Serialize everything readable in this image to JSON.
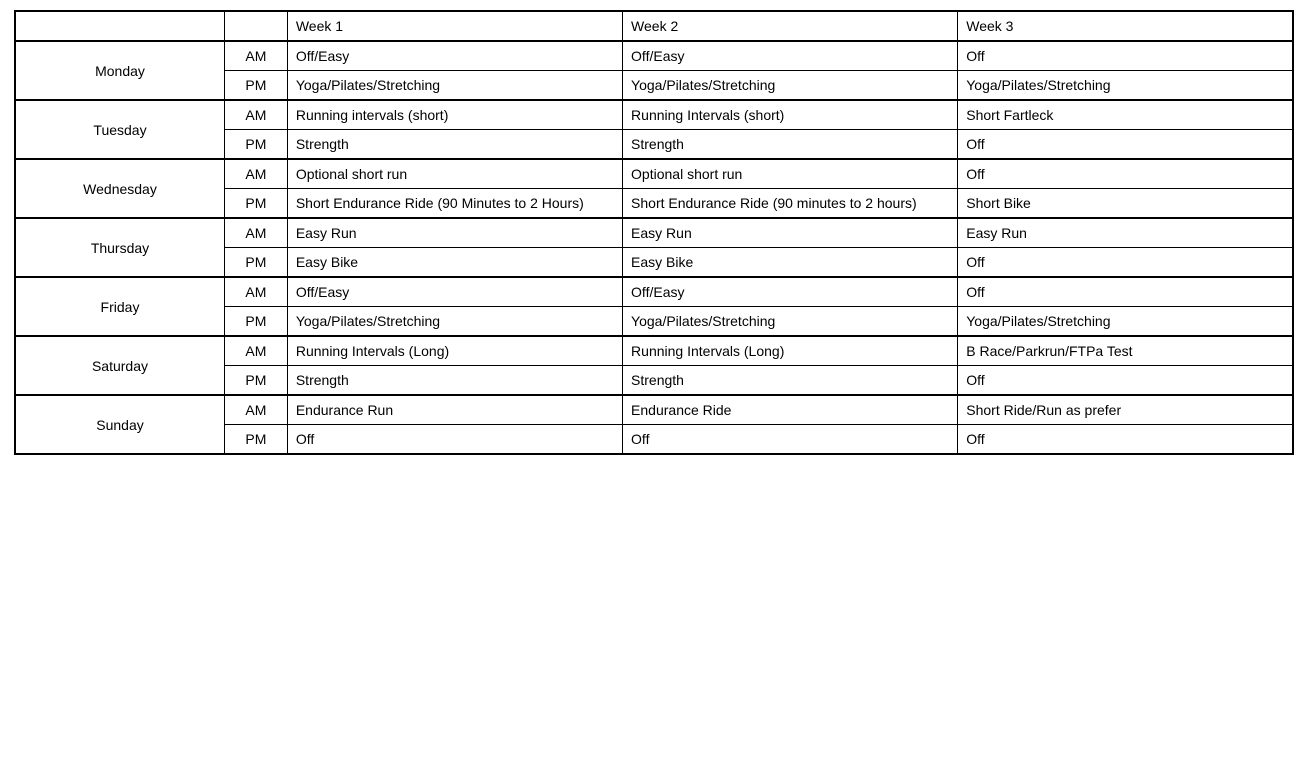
{
  "headers": {
    "col1": "",
    "col2": "",
    "week1": "Week 1",
    "week2": "Week 2",
    "week3": "Week 3"
  },
  "days": [
    {
      "name": "Monday",
      "rows": [
        {
          "period": "AM",
          "w1": "Off/Easy",
          "w2": "Off/Easy",
          "w3": "Off"
        },
        {
          "period": "PM",
          "w1": "Yoga/Pilates/Stretching",
          "w2": "Yoga/Pilates/Stretching",
          "w3": "Yoga/Pilates/Stretching"
        }
      ]
    },
    {
      "name": "Tuesday",
      "rows": [
        {
          "period": "AM",
          "w1": "Running intervals (short)",
          "w2": "Running Intervals (short)",
          "w3": "Short Fartleck"
        },
        {
          "period": "PM",
          "w1": "Strength",
          "w2": "Strength",
          "w3": "Off"
        }
      ]
    },
    {
      "name": "Wednesday",
      "rows": [
        {
          "period": "AM",
          "w1": "Optional short run",
          "w2": "Optional short run",
          "w3": "Off"
        },
        {
          "period": "PM",
          "w1": "Short Endurance Ride (90 Minutes to 2 Hours)",
          "w2": "Short Endurance Ride (90 minutes to 2 hours)",
          "w3": "Short Bike"
        }
      ]
    },
    {
      "name": "Thursday",
      "rows": [
        {
          "period": "AM",
          "w1": "Easy Run",
          "w2": "Easy Run",
          "w3": "Easy Run"
        },
        {
          "period": "PM",
          "w1": "Easy Bike",
          "w2": "Easy Bike",
          "w3": "Off"
        }
      ]
    },
    {
      "name": "Friday",
      "rows": [
        {
          "period": "AM",
          "w1": "Off/Easy",
          "w2": "Off/Easy",
          "w3": "Off"
        },
        {
          "period": "PM",
          "w1": "Yoga/Pilates/Stretching",
          "w2": "Yoga/Pilates/Stretching",
          "w3": "Yoga/Pilates/Stretching"
        }
      ]
    },
    {
      "name": "Saturday",
      "rows": [
        {
          "period": "AM",
          "w1": "Running Intervals (Long)",
          "w2": "Running Intervals (Long)",
          "w3": "B Race/Parkrun/FTPa Test"
        },
        {
          "period": "PM",
          "w1": "Strength",
          "w2": "Strength",
          "w3": "Off"
        }
      ]
    },
    {
      "name": "Sunday",
      "rows": [
        {
          "period": "AM",
          "w1": "Endurance Run",
          "w2": "Endurance Ride",
          "w3": "Short Ride/Run as prefer"
        },
        {
          "period": "PM",
          "w1": "Off",
          "w2": "Off",
          "w3": "Off"
        }
      ]
    }
  ]
}
